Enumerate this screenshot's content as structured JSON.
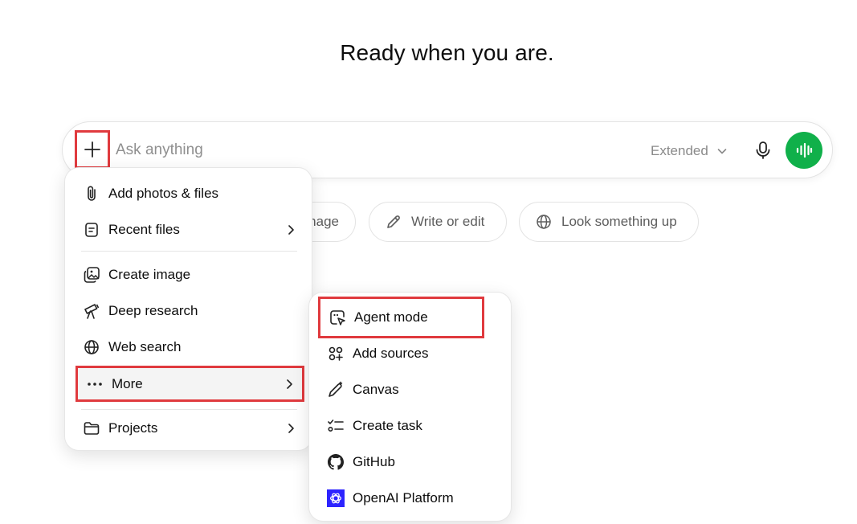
{
  "headline": "Ready when you are.",
  "composer": {
    "placeholder": "Ask anything",
    "model_label": "Extended"
  },
  "suggestions": [
    {
      "label": "nage",
      "icon": "image-icon"
    },
    {
      "label": "Write or edit",
      "icon": "pencil-icon"
    },
    {
      "label": "Look something up",
      "icon": "globe-icon"
    }
  ],
  "menu": {
    "items": [
      {
        "label": "Add photos & files",
        "icon": "paperclip-icon"
      },
      {
        "label": "Recent files",
        "icon": "file-icon",
        "submenu": true
      },
      {
        "label": "Create image",
        "icon": "image-icon"
      },
      {
        "label": "Deep research",
        "icon": "telescope-icon"
      },
      {
        "label": "Web search",
        "icon": "globe-icon"
      },
      {
        "label": "More",
        "icon": "ellipsis-icon",
        "submenu": true
      },
      {
        "label": "Projects",
        "icon": "folder-icon",
        "submenu": true
      }
    ]
  },
  "submenu": {
    "items": [
      {
        "label": "Agent mode",
        "icon": "agent-cursor-icon"
      },
      {
        "label": "Add sources",
        "icon": "sources-icon"
      },
      {
        "label": "Canvas",
        "icon": "canvas-pen-icon"
      },
      {
        "label": "Create task",
        "icon": "task-list-icon"
      },
      {
        "label": "GitHub",
        "icon": "github-icon"
      },
      {
        "label": "OpenAI Platform",
        "icon": "openai-platform-icon"
      }
    ]
  },
  "colors": {
    "accent_green": "#10b04a",
    "highlight_red": "#e03a3e",
    "openai_platform_blue": "#2d24ff"
  }
}
